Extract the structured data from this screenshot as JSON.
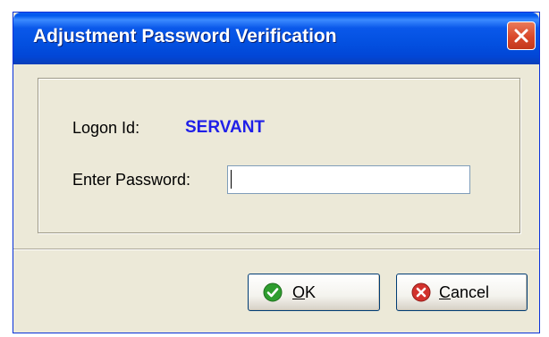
{
  "window": {
    "title": "Adjustment Password Verification"
  },
  "form": {
    "logon_label": "Logon Id:",
    "logon_value": "SERVANT",
    "password_label": "Enter Password:",
    "password_value": ""
  },
  "buttons": {
    "ok": {
      "mnemonic": "O",
      "rest": "K",
      "icon": "check-icon"
    },
    "cancel": {
      "mnemonic": "C",
      "rest": "ancel",
      "icon": "cancel-icon"
    }
  },
  "colors": {
    "titlebar": "#0058ee",
    "logon_value": "#1f1fe8",
    "ok_icon": "#2e9d2e",
    "cancel_icon": "#d2322d",
    "close_button": "#d9482a"
  }
}
